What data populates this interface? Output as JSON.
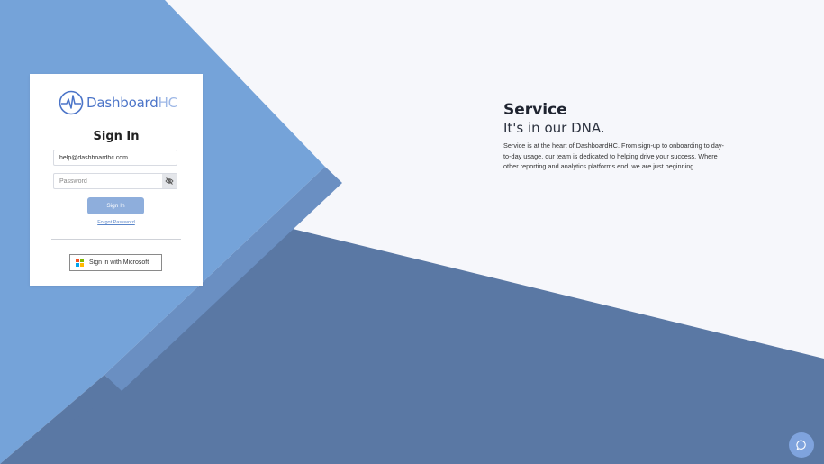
{
  "logo": {
    "brand": "Dashboard",
    "brand_suffix": "HC"
  },
  "signin": {
    "title": "Sign In",
    "email_value": "help@dashboardhc.com",
    "password_placeholder": "Password",
    "submit_label": "Sign In",
    "forgot_label": "Forgot Password",
    "microsoft_label": "Sign in with Microsoft"
  },
  "hero": {
    "title": "Service",
    "subtitle": "It's in our DNA.",
    "body": "Service is at the heart of DashboardHC. From sign-up to onboarding to day-to-day usage, our team is dedicated to helping drive your success. Where other reporting and analytics platforms end, we are just beginning."
  },
  "colors": {
    "light_blue": "#75a3d9",
    "mid_blue": "#6a8fc2",
    "dark_blue": "#5a78a4",
    "background": "#f6f7fb",
    "button": "#8eaedc"
  },
  "icons": {
    "logo": "heartbeat-circle-icon",
    "password_toggle": "eye-slash-icon",
    "microsoft": "microsoft-logo-icon",
    "chat": "chat-bubble-icon"
  }
}
